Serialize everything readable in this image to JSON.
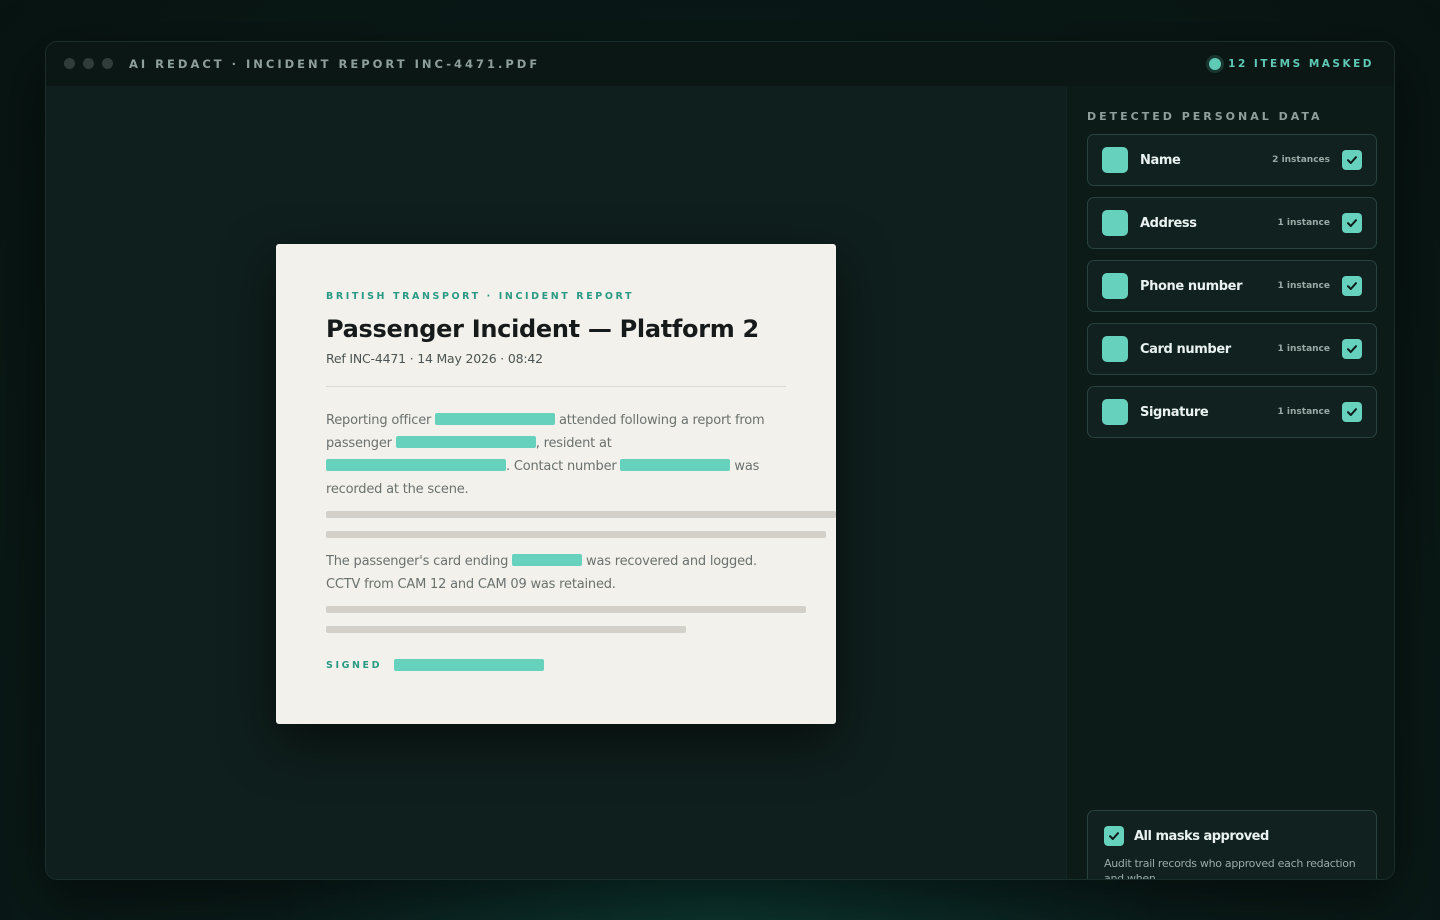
{
  "window": {
    "title": "AI REDACT · INCIDENT REPORT INC-4471.PDF",
    "status": "12 ITEMS MASKED"
  },
  "document": {
    "kicker": "BRITISH TRANSPORT · INCIDENT REPORT",
    "title": "Passenger Incident — Platform 2",
    "ref": "Ref INC-4471 · 14 May 2026 · 08:42",
    "para1": {
      "t1": "Reporting officer ",
      "t2": " attended following a report from passenger ",
      "t3": ", resident at ",
      "t4": ". Contact number ",
      "t5": " was recorded at the scene."
    },
    "para2": {
      "t1": "The passenger's card ending ",
      "t2": " was recovered and logged. CCTV from CAM 12 and CAM 09 was retained."
    },
    "signed_label": "SIGNED"
  },
  "sidebar": {
    "heading": "DETECTED PERSONAL DATA",
    "items": [
      {
        "label": "Name",
        "count": "2 instances"
      },
      {
        "label": "Address",
        "count": "1 instance"
      },
      {
        "label": "Phone number",
        "count": "1 instance"
      },
      {
        "label": "Card number",
        "count": "1 instance"
      },
      {
        "label": "Signature",
        "count": "1 instance"
      }
    ],
    "approval": {
      "label": "All masks approved",
      "description": "Audit trail records who approved each redaction and when."
    }
  },
  "colors": {
    "accent": "#66d1bd",
    "background": "#0f1f1d",
    "paper": "#f3f1ec"
  },
  "icons": {
    "check": "check-icon",
    "window_controls": "window-dot"
  }
}
